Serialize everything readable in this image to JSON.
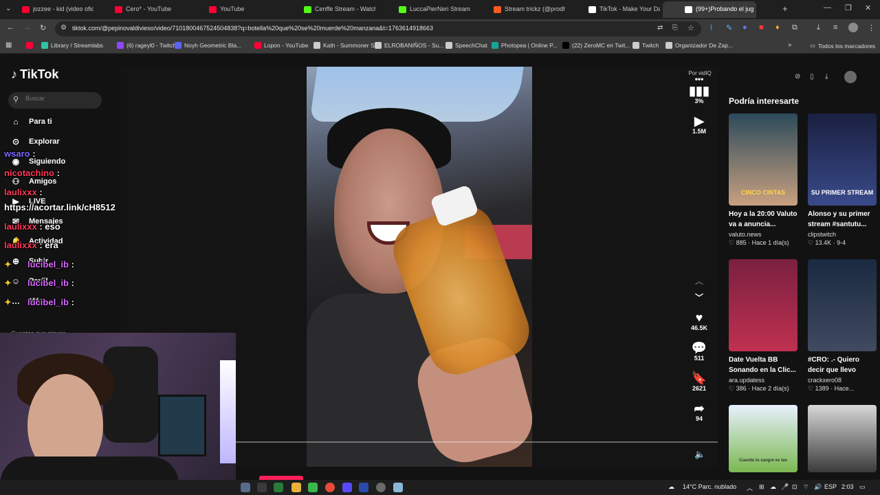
{
  "browser": {
    "tabs": [
      {
        "label": "jozzee - kid (video oficial)",
        "color": "#ff0033"
      },
      {
        "label": "Cero* - YouTube",
        "color": "#ff0033"
      },
      {
        "label": "YouTube",
        "color": "#ff0033"
      },
      {
        "label": "Cenffe Stream - Watch Li",
        "color": "#53fc18"
      },
      {
        "label": "LuccaPierNeri Stream",
        "color": "#53fc18"
      },
      {
        "label": "Stream trickz (@prodhaz",
        "color": "#ff5a1f"
      },
      {
        "label": "TikTok - Make Your Day",
        "color": "#ffffff"
      },
      {
        "label": "(99+)Probando el jug",
        "color": "#ffffff"
      }
    ],
    "url": "tiktok.com/@pepinovaldivieso/video/7101800467524504838?q=botella%20que%20se%20muerde%20manzana&t=1763614918663",
    "bookmarks": [
      {
        "label": "",
        "color": "#ff0033"
      },
      {
        "label": "Library / Streamlabs",
        "color": "#31c3a2"
      },
      {
        "label": "(6) rageyl0 - Twitch",
        "color": "#9146ff"
      },
      {
        "label": "Noyh Geometric Bla...",
        "color": "#5865f2"
      },
      {
        "label": "Lopon - YouTube",
        "color": "#ff0033"
      },
      {
        "label": "Kath - Summoner St...",
        "color": "#cccccc"
      },
      {
        "label": "ELROBANIÑOS - Su...",
        "color": "#cccccc"
      },
      {
        "label": "SpeechChat",
        "color": "#cccccc"
      },
      {
        "label": "Photopea | Online P...",
        "color": "#18a497"
      },
      {
        "label": "(22) ZeroMC en Twit...",
        "color": "#000000"
      },
      {
        "label": "Twitch",
        "color": "#cccccc"
      },
      {
        "label": "Organizador De Zap...",
        "color": "#cccccc"
      }
    ],
    "all_bookmarks": "Todos los marcadores"
  },
  "tiktok": {
    "logo": "TikTok",
    "search_placeholder": "Buscar",
    "nav": [
      {
        "label": "Para ti",
        "icon": "home-icon"
      },
      {
        "label": "Explorar",
        "icon": "compass-icon"
      },
      {
        "label": "Siguiendo",
        "icon": "following-icon"
      },
      {
        "label": "Amigos",
        "icon": "friends-icon"
      },
      {
        "label": "LIVE",
        "icon": "live-icon"
      },
      {
        "label": "Mensajes",
        "icon": "message-icon"
      },
      {
        "label": "Actividad",
        "icon": "bell-icon"
      },
      {
        "label": "Subir",
        "icon": "upload-icon"
      },
      {
        "label": "Perfil",
        "icon": "profile-icon"
      },
      {
        "label": "Más",
        "icon": "more-icon"
      }
    ],
    "following_header": "Cuentas que sigues",
    "video": {
      "by": "Por vidIQ",
      "vidiq_pct": "3%",
      "views": "1.5M",
      "likes": "46.5K",
      "comments": "511",
      "saves": "2621",
      "shares": "94"
    },
    "recommendations_title": "Podría interesarte",
    "recommendations": [
      {
        "title": "Hoy a la 20:00 Valuto va a anuncia...",
        "author": "valuto.news",
        "likes": "885",
        "age": "Hace 1 día(s)",
        "thumb_text": "CINCO CINTAS",
        "colors": [
          "#2b4a5a",
          "#c9a080"
        ]
      },
      {
        "title": "Alonso y su primer stream #santutu...",
        "author": "clipstwitch",
        "likes": "13.4K",
        "age": "9-4",
        "thumb_text": "SU PRIMER STREAM",
        "colors": [
          "#1a2040",
          "#3a4a8a"
        ]
      },
      {
        "title": "Date Vuelta BB Sonando en la Clic...",
        "author": "ara.updatess",
        "likes": "386",
        "age": "Hace 2 día(s)",
        "thumb_text": "",
        "colors": [
          "#7a2040",
          "#c03050"
        ]
      },
      {
        "title": "#CRO: .- Quiero decir que llevo mas...",
        "author": "crackxero08",
        "likes": "1389",
        "age": "Hace...",
        "thumb_text": "",
        "colors": [
          "#1a2a40",
          "#404a60"
        ]
      },
      {
        "title": "",
        "author": "",
        "likes": "",
        "age": "",
        "thumb_text": "Cuando tu sangre es tan",
        "colors": [
          "#e8f0ff",
          "#7ab850"
        ]
      },
      {
        "title": "",
        "author": "",
        "likes": "",
        "age": "",
        "thumb_text": "",
        "colors": [
          "#d8d8d8",
          "#3a3a3a"
        ]
      }
    ]
  },
  "chat_overlay": [
    {
      "user": "wsaro",
      "text": ":",
      "color": "#7a6aff"
    },
    {
      "user": "nicotachino",
      "text": ":",
      "color": "#ff3a5a"
    },
    {
      "user": "laulixxx",
      "text": ":",
      "color": "#ff3a5a"
    },
    {
      "user": "",
      "text": "https://acortar.link/cH8512",
      "color": "#ffffff"
    },
    {
      "user": "laulixxx",
      "text": ": eso",
      "color": "#ff3a5a"
    },
    {
      "user": "laulixxx",
      "text": ": era",
      "color": "#ff3a5a"
    },
    {
      "user": "lucibel_ib",
      "text": ":",
      "color": "#d86aff"
    },
    {
      "user": "lucibel_ib",
      "text": ":",
      "color": "#d86aff"
    },
    {
      "user": "lucibel_ib",
      "text": ":",
      "color": "#d86aff"
    }
  ],
  "taskbar": {
    "weather": "14°C  Parc. nublado",
    "lang": "ESP",
    "time": "2:03"
  }
}
